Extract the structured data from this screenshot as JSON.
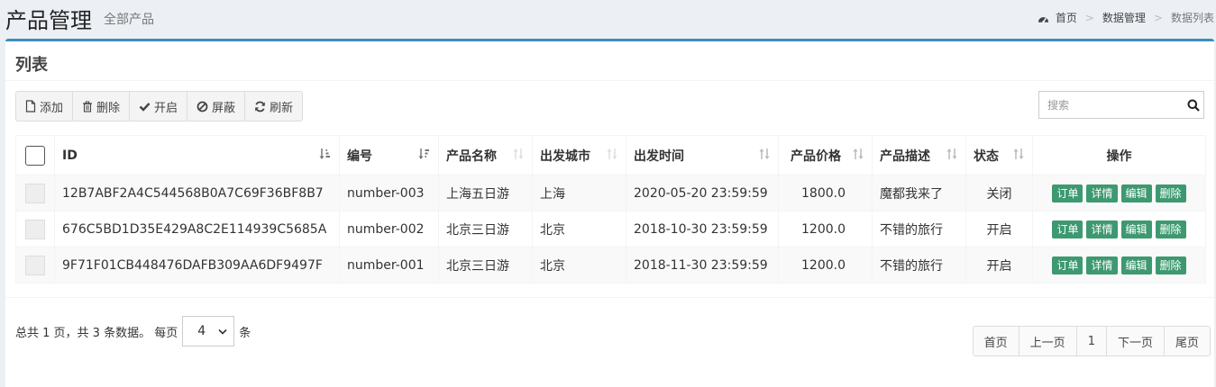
{
  "header": {
    "title": "产品管理",
    "subtitle": "全部产品",
    "breadcrumb": [
      "首页",
      "数据管理",
      "数据列表"
    ]
  },
  "box": {
    "title": "列表",
    "accent_color": "#3c8dbc"
  },
  "toolbar": {
    "add_label": "添加",
    "delete_label": "删除",
    "enable_label": "开启",
    "block_label": "屏蔽",
    "refresh_label": "刷新"
  },
  "search": {
    "placeholder": "搜索",
    "value": ""
  },
  "table": {
    "columns": [
      "ID",
      "编号",
      "产品名称",
      "出发城市",
      "出发时间",
      "产品价格",
      "产品描述",
      "状态",
      "操作"
    ],
    "rows": [
      {
        "id": "12B7ABF2A4C544568B0A7C69F36BF8B7",
        "num": "number-003",
        "name": "上海五日游",
        "city": "上海",
        "time": "2020-05-20 23:59:59",
        "price": "1800.0",
        "desc": "魔都我来了",
        "status": "关闭"
      },
      {
        "id": "676C5BD1D35E429A8C2E114939C5685A",
        "num": "number-002",
        "name": "北京三日游",
        "city": "北京",
        "time": "2018-10-30 23:59:59",
        "price": "1200.0",
        "desc": "不错的旅行",
        "status": "开启"
      },
      {
        "id": "9F71F01CB448476DAFB309AA6DF9497F",
        "num": "number-001",
        "name": "北京三日游",
        "city": "北京",
        "time": "2018-11-30 23:59:59",
        "price": "1200.0",
        "desc": "不错的旅行",
        "status": "开启"
      }
    ],
    "row_actions": [
      "订单",
      "详情",
      "编辑",
      "删除"
    ],
    "action_color": "#3d9970"
  },
  "footer": {
    "summary": "总共 1 页，共 3 条数据。 每页",
    "pagesize": "4",
    "pagesize_suffix": "条",
    "pagination": [
      "首页",
      "上一页",
      "1",
      "下一页",
      "尾页"
    ]
  }
}
